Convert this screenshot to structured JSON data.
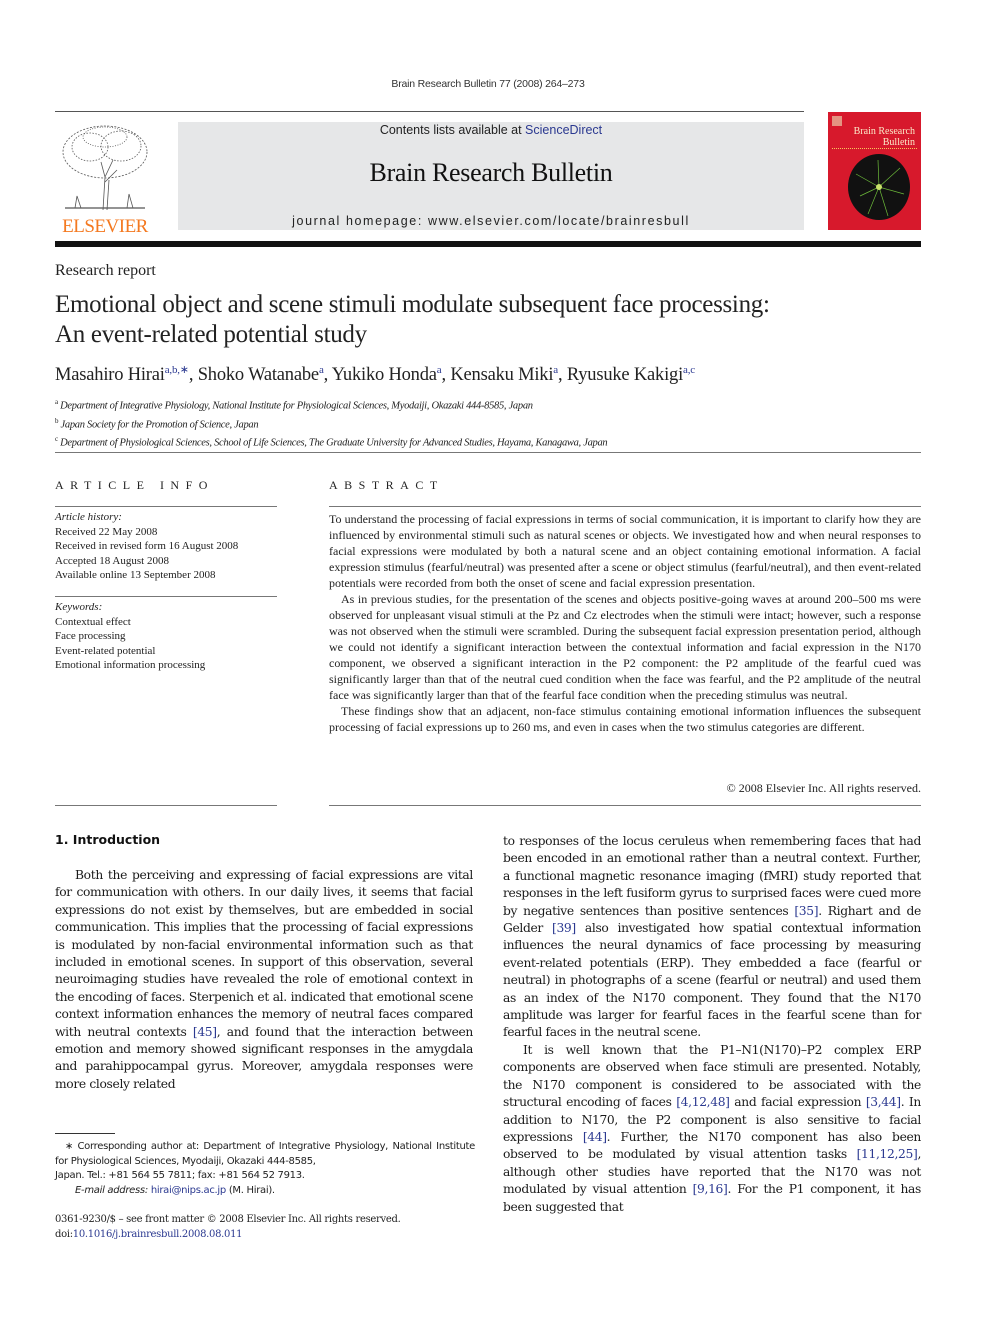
{
  "running_head": "Brain Research Bulletin 77 (2008) 264–273",
  "masthead": {
    "publisher_logo_text": "ELSEVIER",
    "contents_prefix": "Contents lists available at ",
    "contents_link": "ScienceDirect",
    "journal_title": "Brain Research Bulletin",
    "homepage": "journal homepage: www.elsevier.com/locate/brainresbull",
    "cover_title_line1": "Brain Research",
    "cover_title_line2": "Bulletin"
  },
  "colors": {
    "elsevier_orange": "#f47920",
    "link_blue": "#2b3990",
    "cover_red": "#d7192c",
    "masthead_gray": "#e6e7e8"
  },
  "article_type": "Research report",
  "title_line1": "Emotional object and scene stimuli modulate subsequent face processing:",
  "title_line2": "An event-related potential study",
  "authors": [
    {
      "name": "Masahiro Hirai",
      "sup": "a,b,∗"
    },
    {
      "name": "Shoko Watanabe",
      "sup": "a"
    },
    {
      "name": "Yukiko Honda",
      "sup": "a"
    },
    {
      "name": "Kensaku Miki",
      "sup": "a"
    },
    {
      "name": "Ryusuke Kakigi",
      "sup": "a,c"
    }
  ],
  "affiliations": [
    {
      "mark": "a",
      "text": "Department of Integrative Physiology, National Institute for Physiological Sciences, Myodaiji, Okazaki 444-8585, Japan"
    },
    {
      "mark": "b",
      "text": "Japan Society for the Promotion of Science, Japan"
    },
    {
      "mark": "c",
      "text": "Department of Physiological Sciences, School of Life Sciences, The Graduate University for Advanced Studies, Hayama, Kanagawa, Japan"
    }
  ],
  "article_info": {
    "heading": "ARTICLE INFO",
    "history_label": "Article history:",
    "history": [
      "Received 22 May 2008",
      "Received in revised form 16 August 2008",
      "Accepted 18 August 2008",
      "Available online 13 September 2008"
    ],
    "keywords_label": "Keywords:",
    "keywords": [
      "Contextual effect",
      "Face processing",
      "Event-related potential",
      "Emotional information processing"
    ]
  },
  "abstract": {
    "heading": "ABSTRACT",
    "paragraphs": [
      "To understand the processing of facial expressions in terms of social communication, it is important to clarify how they are influenced by environmental stimuli such as natural scenes or objects. We investigated how and when neural responses to facial expressions were modulated by both a natural scene and an object containing emotional information. A facial expression stimulus (fearful/neutral) was presented after a scene or object stimulus (fearful/neutral), and then event-related potentials were recorded from both the onset of scene and facial expression presentation.",
      "As in previous studies, for the presentation of the scenes and objects positive-going waves at around 200–500 ms were observed for unpleasant visual stimuli at the Pz and Cz electrodes when the stimuli were intact; however, such a response was not observed when the stimuli were scrambled. During the subsequent facial expression presentation period, although we could not identify a significant interaction between the contextual information and facial expression in the N170 component, we observed a significant interaction in the P2 component: the P2 amplitude of the fearful cued was significantly larger than that of the neutral cued condition when the face was fearful, and the P2 amplitude of the neutral face was significantly larger than that of the fearful face condition when the preceding stimulus was neutral.",
      "These findings show that an adjacent, non-face stimulus containing emotional information influences the subsequent processing of facial expressions up to 260 ms, and even in cases when the two stimulus categories are different."
    ],
    "copyright": "© 2008 Elsevier Inc. All rights reserved."
  },
  "intro": {
    "heading": "1.  Introduction",
    "left_p1_a": "Both the perceiving and expressing of facial expressions are vital for communication with others. In our daily lives, it seems that facial expressions do not exist by themselves, but are embedded in social communication. This implies that the processing of facial expressions is modulated by non-facial environmental information such as that included in emotional scenes. In support of this observation, several neuroimaging studies have revealed the role of emotional context in the encoding of faces. Sterpenich et al. indicated that emotional scene context information enhances the memory of neutral faces compared with neutral contexts ",
    "ref_45": "[45]",
    "left_p1_b": ", and found that the interaction between emotion and memory showed significant responses in the amygdala and parahippocampal gyrus. Moreover, amygdala responses were more closely related",
    "right_p1_a": "to responses of the locus ceruleus when remembering faces that had been encoded in an emotional rather than a neutral context. Further, a functional magnetic resonance imaging (fMRI) study reported that responses in the left fusiform gyrus to surprised faces were cued more by negative sentences than positive sentences ",
    "ref_35": "[35]",
    "right_p1_b": ". Righart and de Gelder ",
    "ref_39": "[39]",
    "right_p1_c": " also investigated how spatial contextual information influences the neural dynamics of face processing by measuring event-related potentials (ERP). They embedded a face (fearful or neutral) in photographs of a scene (fearful or neutral) and used them as an index of the N170 component. They found that the N170 amplitude was larger for fearful faces in the fearful scene than for fearful faces in the neutral scene.",
    "right_p2_a": "It is well known that the P1–N1(N170)–P2 complex ERP components are observed when face stimuli are presented. Notably, the N170 component is considered to be associated with the structural encoding of faces ",
    "ref_4_12_48": "[4,12,48]",
    "right_p2_b": " and facial expression ",
    "ref_3_44": "[3,44]",
    "right_p2_c": ". In addition to N170, the P2 component is also sensitive to facial expressions ",
    "ref_44": "[44]",
    "right_p2_d": ". Further, the N170 component has also been observed to be modulated by visual attention tasks ",
    "ref_11_12_25": "[11,12,25]",
    "right_p2_e": ", although other studies have reported that the N170 was not modulated by visual attention ",
    "ref_9_16": "[9,16]",
    "right_p2_f": ". For the P1 component, it has been suggested that"
  },
  "footnote": {
    "star_text": "∗  Corresponding author at: Department of Integrative Physiology, National Institute for Physiological Sciences, Myodaiji, Okazaki 444-8585,",
    "contact": "Japan. Tel.: +81 564 55 7811; fax: +81 564 52 7913.",
    "email_label": "E-mail address:",
    "email": "hirai@nips.ac.jp",
    "email_suffix": " (M. Hirai)."
  },
  "frontmatter": {
    "issn_line": "0361-9230/$ – see front matter © 2008 Elsevier Inc. All rights reserved.",
    "doi_prefix": "doi:",
    "doi": "10.1016/j.brainresbull.2008.08.011"
  }
}
